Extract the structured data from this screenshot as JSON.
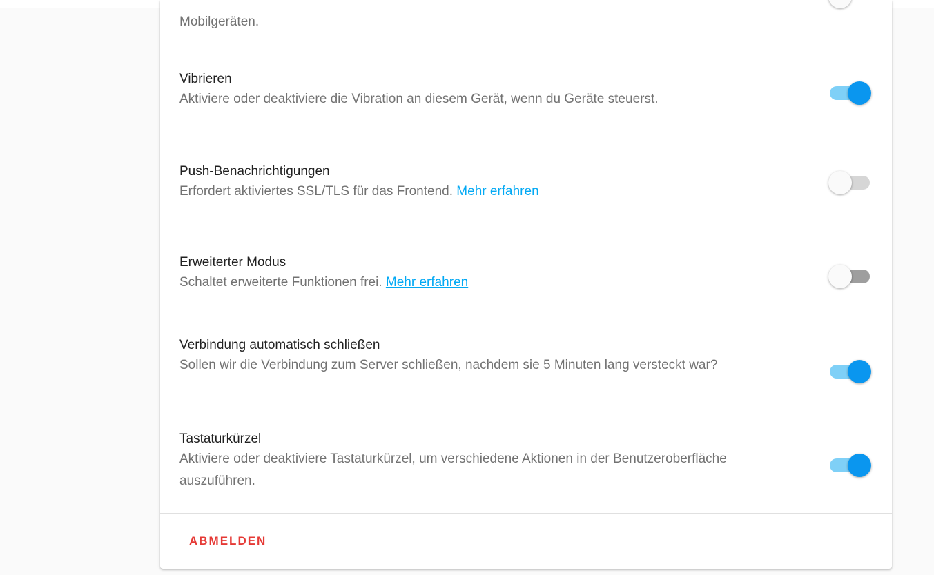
{
  "settings": {
    "prev_desc_tail": "Mobilgeräten.",
    "vibrate": {
      "title": "Vibrieren",
      "desc": "Aktiviere oder deaktiviere die Vibration an diesem Gerät, wenn du Geräte steuerst.",
      "enabled": true
    },
    "push": {
      "title": "Push-Benachrichtigungen",
      "desc": "Erfordert aktiviertes SSL/TLS für das Frontend.",
      "link": "Mehr erfahren",
      "enabled": false,
      "disabled": true
    },
    "advanced": {
      "title": "Erweiterter Modus",
      "desc": "Schaltet erweiterte Funktionen frei.",
      "link": "Mehr erfahren",
      "enabled": false
    },
    "auto_close": {
      "title": "Verbindung automatisch schließen",
      "desc": "Sollen wir die Verbindung zum Server schließen, nachdem sie 5 Minuten lang versteckt war?",
      "enabled": true
    },
    "shortcuts": {
      "title": "Tastaturkürzel",
      "desc": "Aktiviere oder deaktiviere Tastaturkürzel, um verschiedene Aktionen in der Benutzeroberfläche auszuführen.",
      "enabled": true
    }
  },
  "logout_label": "ABMELDEN",
  "colors": {
    "accent": "#0a96ef",
    "accent_track": "#7fd0f7",
    "link": "#03a9f4",
    "logout": "#e53935"
  }
}
